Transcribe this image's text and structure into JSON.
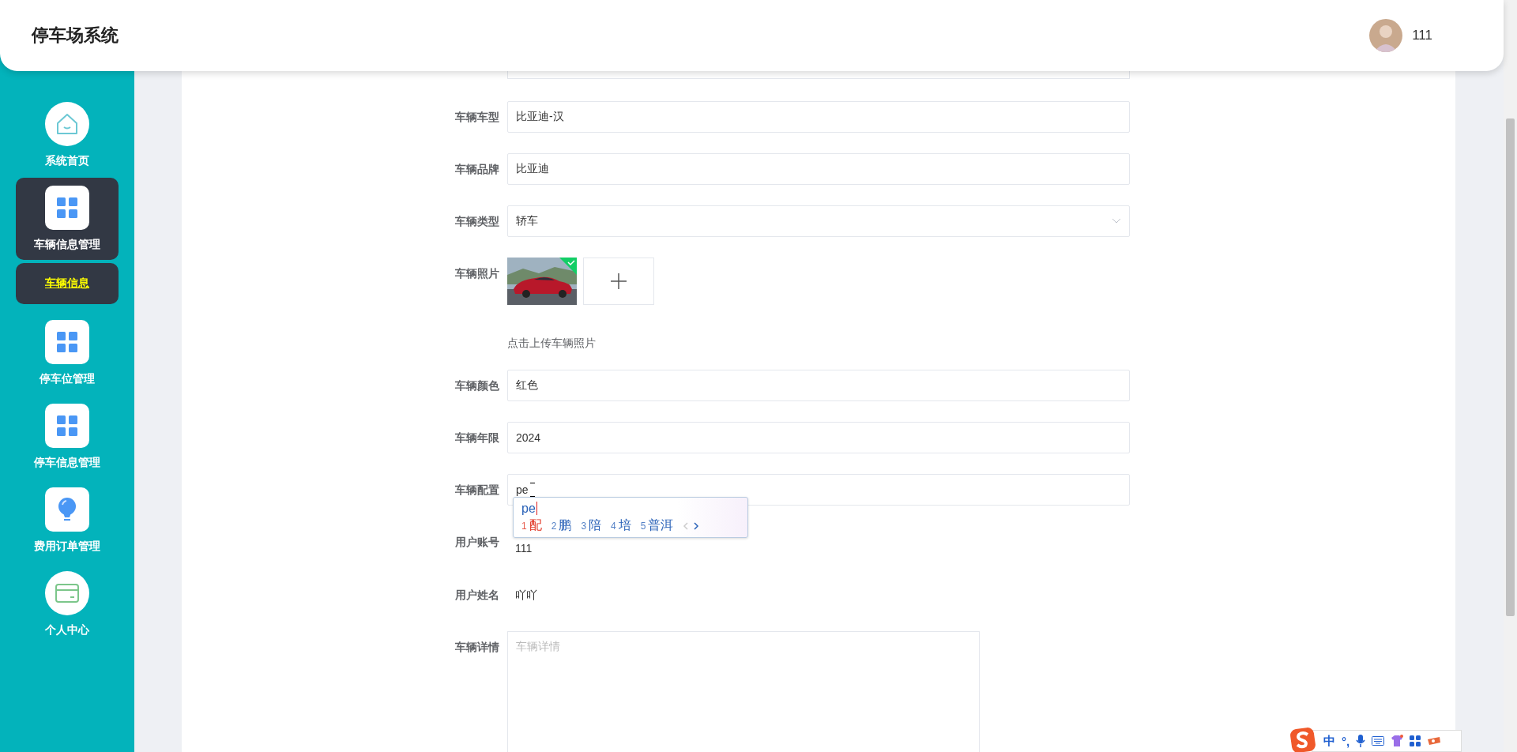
{
  "app": {
    "title": "停车场系统"
  },
  "user": {
    "name": "111"
  },
  "sidebar": {
    "items": [
      {
        "label": "系统首页",
        "kind": "home",
        "selected": false
      },
      {
        "label": "车辆信息管理",
        "kind": "grid",
        "selected": true,
        "children": [
          {
            "label": "车辆信息",
            "selected": true
          }
        ]
      },
      {
        "label": "停车位管理",
        "kind": "grid",
        "selected": false
      },
      {
        "label": "停车信息管理",
        "kind": "grid",
        "selected": false
      },
      {
        "label": "费用订单管理",
        "kind": "bulb",
        "selected": false
      },
      {
        "label": "个人中心",
        "kind": "card",
        "selected": false
      }
    ]
  },
  "form": {
    "fields": [
      {
        "kind": "partial"
      },
      {
        "kind": "input",
        "label": "车辆车型",
        "value": "比亚迪-汉"
      },
      {
        "kind": "input",
        "label": "车辆品牌",
        "value": "比亚迪"
      },
      {
        "kind": "select",
        "label": "车辆类型",
        "value": "轿车"
      },
      {
        "kind": "upload",
        "label": "车辆照片",
        "hint": "点击上传车辆照片",
        "uploaded": true
      },
      {
        "kind": "input",
        "label": "车辆颜色",
        "value": "红色"
      },
      {
        "kind": "input",
        "label": "车辆年限",
        "value": "2024"
      },
      {
        "kind": "input",
        "label": "车辆配置",
        "value": "pe"
      },
      {
        "kind": "text",
        "label": "用户账号",
        "value": "111"
      },
      {
        "kind": "text",
        "label": "用户姓名",
        "value": "吖吖"
      },
      {
        "kind": "textarea",
        "label": "车辆详情",
        "placeholder": "车辆详情"
      }
    ]
  },
  "ime": {
    "composition": "pe",
    "candidates": [
      {
        "index": "1",
        "text": "配",
        "selected": true
      },
      {
        "index": "2",
        "text": "鹏",
        "selected": false
      },
      {
        "index": "3",
        "text": "陪",
        "selected": false
      },
      {
        "index": "4",
        "text": "培",
        "selected": false
      },
      {
        "index": "5",
        "text": "普洱",
        "selected": false
      }
    ]
  },
  "ime_toolbar": {
    "mode": "中",
    "punctuation": "°,"
  }
}
